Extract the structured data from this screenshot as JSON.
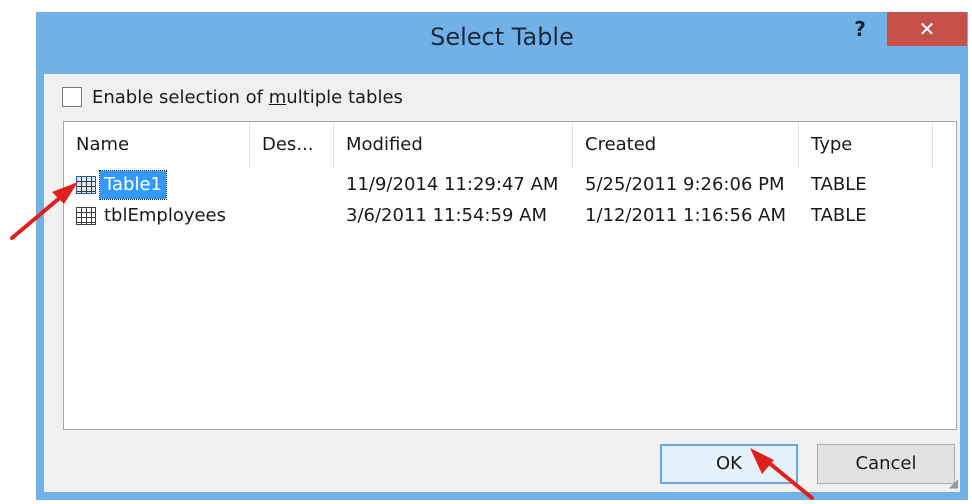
{
  "window": {
    "title": "Select Table",
    "help_label": "?",
    "close_label": "✕"
  },
  "checkbox": {
    "label_before": "Enable selection of ",
    "label_mnemonic": "m",
    "label_after": "ultiple tables",
    "checked": false
  },
  "table": {
    "columns": [
      "Name",
      "Des...",
      "Modified",
      "Created",
      "Type"
    ],
    "rows": [
      {
        "name": "Table1",
        "description": "",
        "modified": "11/9/2014 11:29:47 AM",
        "created": "5/25/2011 9:26:06 PM",
        "type": "TABLE",
        "selected": true
      },
      {
        "name": "tblEmployees",
        "description": "",
        "modified": "3/6/2011 11:54:59 AM",
        "created": "1/12/2011 1:16:56 AM",
        "type": "TABLE",
        "selected": false
      }
    ]
  },
  "buttons": {
    "ok_label": "OK",
    "cancel_label": "Cancel"
  },
  "colors": {
    "titlebar": "#71b1e8",
    "close_button": "#c7504b",
    "selection": "#3399ff",
    "annotation_arrow": "#e0201c"
  }
}
